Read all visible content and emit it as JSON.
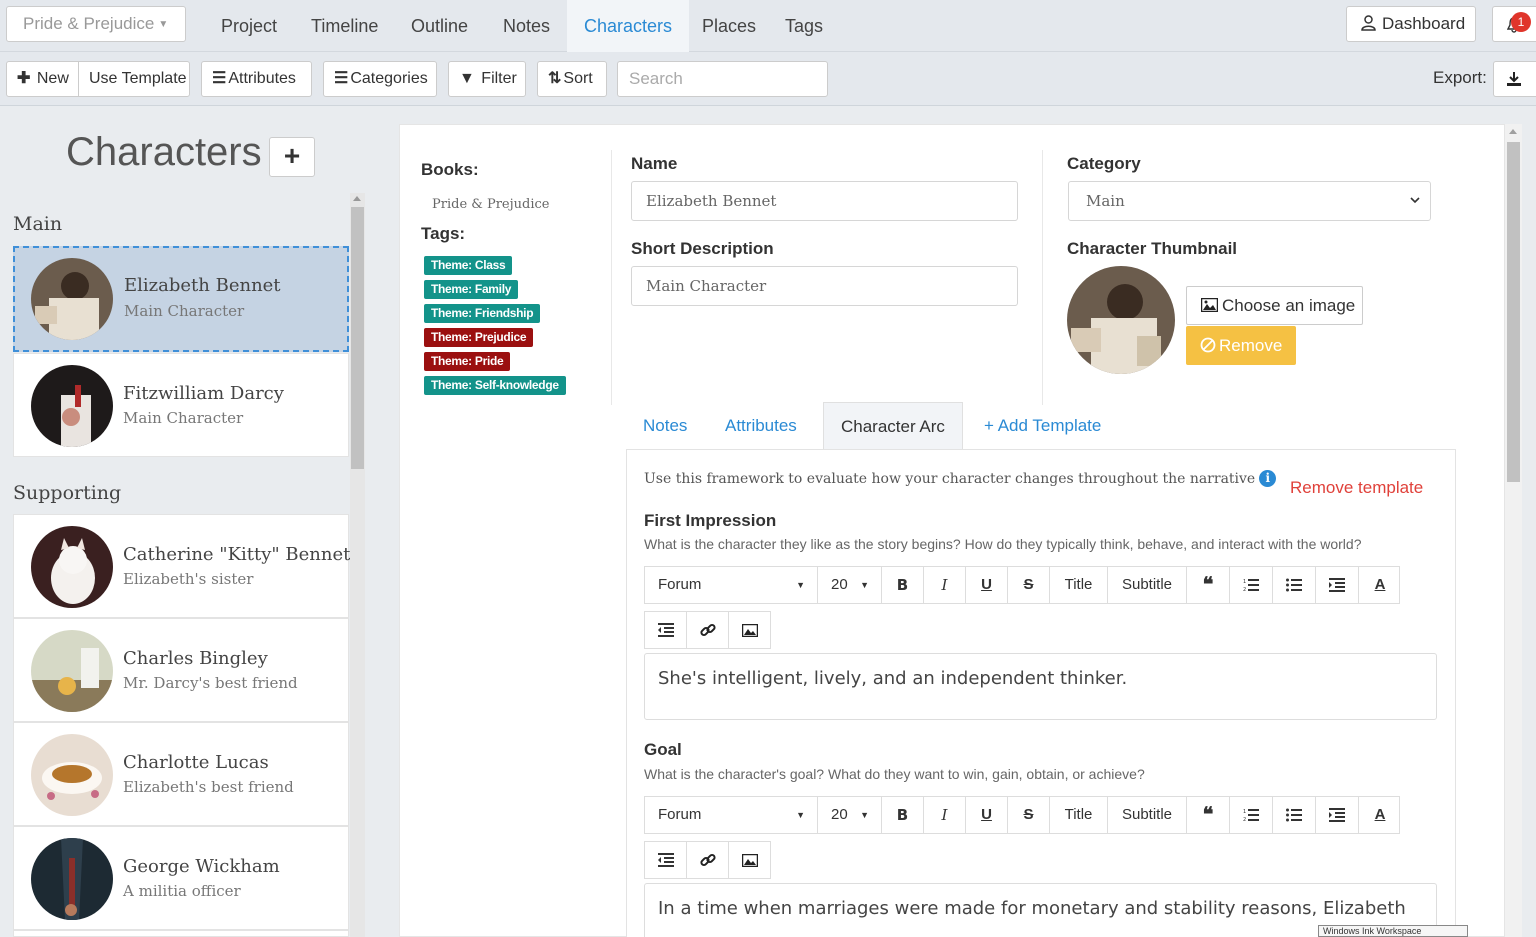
{
  "topnav": {
    "book_selector": "Pride & Prejudice",
    "tabs": [
      {
        "label": "Project"
      },
      {
        "label": "Timeline"
      },
      {
        "label": "Outline"
      },
      {
        "label": "Notes"
      },
      {
        "label": "Characters",
        "active": true
      },
      {
        "label": "Places"
      },
      {
        "label": "Tags"
      }
    ],
    "dashboard_label": "Dashboard",
    "notification_count": "1"
  },
  "toolbar": {
    "new_label": "New",
    "use_template_label": "Use Template",
    "attributes_label": "Attributes",
    "categories_label": "Categories",
    "filter_label": "Filter",
    "sort_label": "Sort",
    "search_placeholder": "Search",
    "export_label": "Export:"
  },
  "sidebar": {
    "title": "Characters",
    "add_icon": "plus-icon",
    "groups": [
      {
        "label": "Main",
        "characters": [
          {
            "name": "Elizabeth Bennet",
            "description": "Main Character",
            "selected": true
          },
          {
            "name": "Fitzwilliam Darcy",
            "description": "Main Character"
          }
        ]
      },
      {
        "label": "Supporting",
        "characters": [
          {
            "name": "Catherine \"Kitty\" Bennet",
            "description": "Elizabeth's sister"
          },
          {
            "name": "Charles Bingley",
            "description": "Mr. Darcy's best friend"
          },
          {
            "name": "Charlotte Lucas",
            "description": "Elizabeth's best friend"
          },
          {
            "name": "George Wickham",
            "description": "A militia officer"
          }
        ]
      }
    ]
  },
  "detail": {
    "books_label": "Books:",
    "books": [
      "Pride & Prejudice"
    ],
    "tags_label": "Tags:",
    "tags": [
      {
        "label": "Theme: Class",
        "color": "#13938a"
      },
      {
        "label": "Theme: Family",
        "color": "#13938a"
      },
      {
        "label": "Theme: Friendship",
        "color": "#13938a"
      },
      {
        "label": "Theme: Prejudice",
        "color": "#9b1010"
      },
      {
        "label": "Theme: Pride",
        "color": "#9b1010"
      },
      {
        "label": "Theme: Self-knowledge",
        "color": "#13938a"
      }
    ],
    "name_label": "Name",
    "name_value": "Elizabeth Bennet",
    "short_desc_label": "Short Description",
    "short_desc_value": "Main Character",
    "category_label": "Category",
    "category_value": "Main",
    "thumbnail_label": "Character Thumbnail",
    "choose_image_label": "Choose an image",
    "remove_label": "Remove",
    "subtabs": [
      {
        "label": "Notes"
      },
      {
        "label": "Attributes"
      },
      {
        "label": "Character Arc",
        "active": true
      },
      {
        "label": "+ Add Template"
      }
    ],
    "arc_description": "Use this framework to evaluate how your character changes throughout the narrative",
    "remove_template_label": "Remove template",
    "editor_font": "Forum",
    "editor_size": "20",
    "editor_title_btn": "Title",
    "editor_subtitle_btn": "Subtitle",
    "sections": [
      {
        "title": "First Impression",
        "question": "What is the character they like as the story begins? How do they typically think, behave, and interact with the world?",
        "content": "She's intelligent, lively, and an independent thinker."
      },
      {
        "title": "Goal",
        "question": "What is the character's goal? What do they want to win, gain, obtain, or achieve?",
        "content": "In a time when marriages were made for monetary and stability reasons, Elizabeth"
      }
    ],
    "ink_popup": "Windows Ink Workspace"
  }
}
